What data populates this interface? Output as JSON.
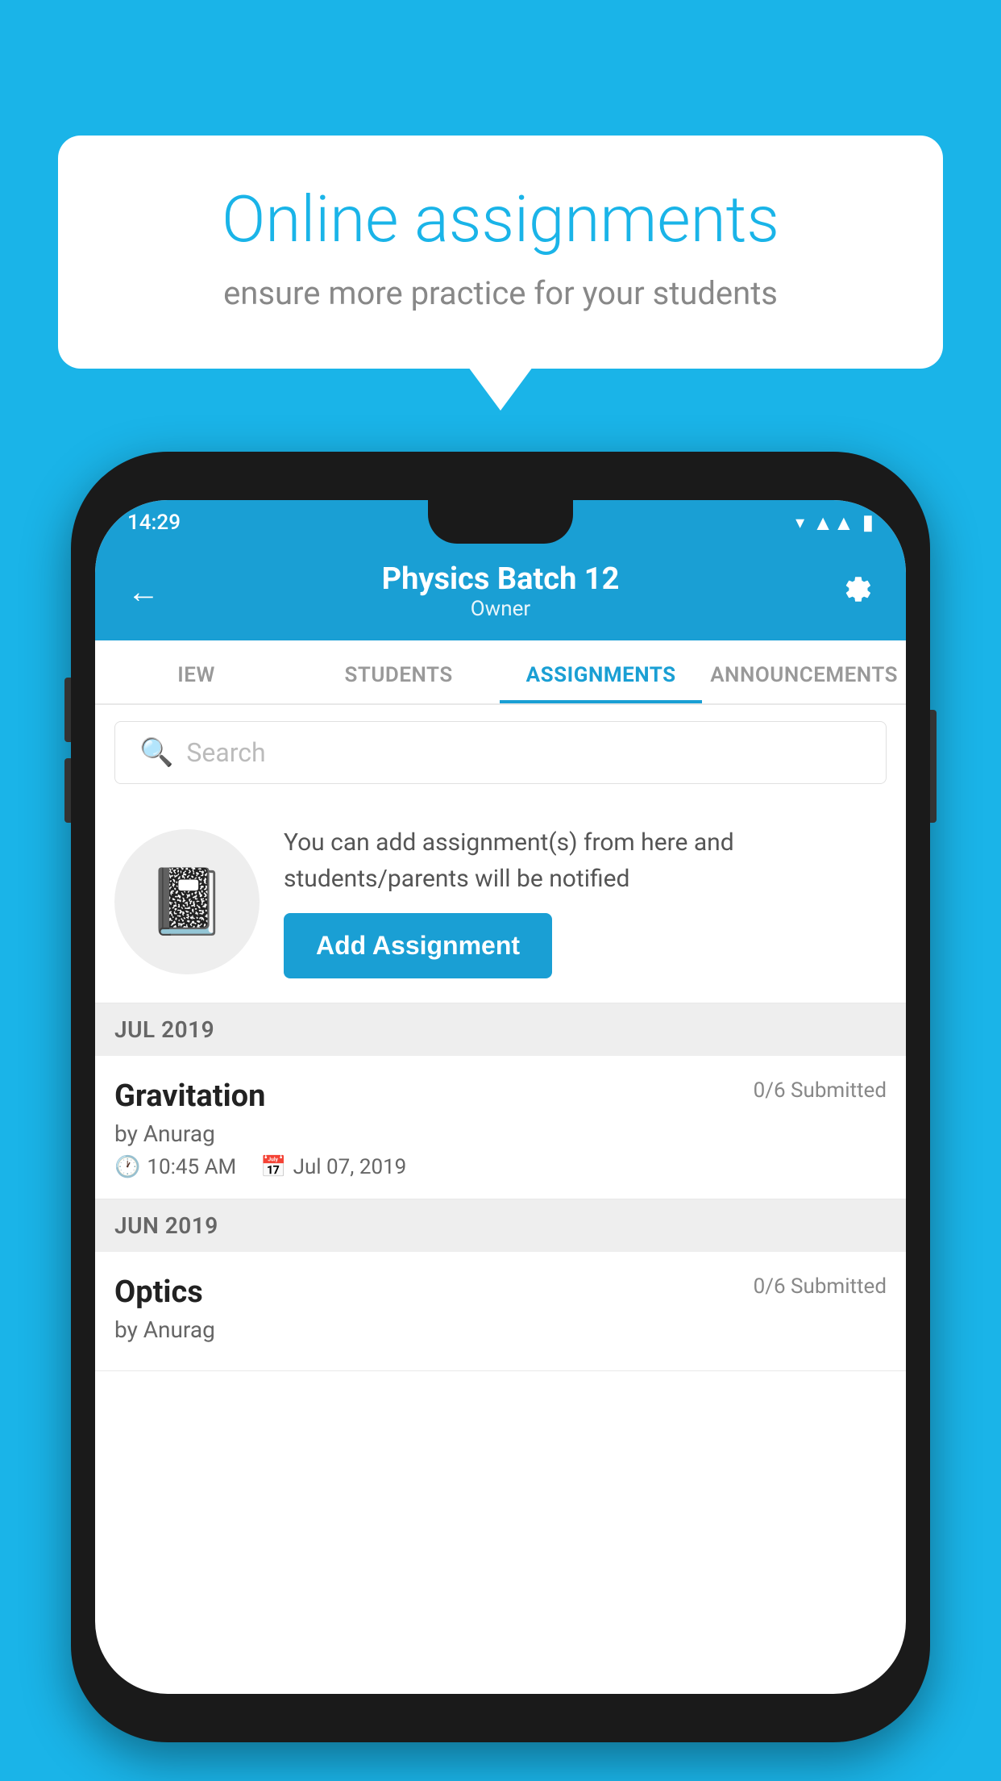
{
  "background_color": "#1ab4e8",
  "speech_bubble": {
    "title": "Online assignments",
    "subtitle": "ensure more practice for your students"
  },
  "status_bar": {
    "time": "14:29",
    "icons": [
      "wifi",
      "signal",
      "battery"
    ]
  },
  "header": {
    "title": "Physics Batch 12",
    "subtitle": "Owner",
    "back_label": "←",
    "settings_label": "⚙"
  },
  "tabs": [
    {
      "label": "IEW",
      "active": false
    },
    {
      "label": "STUDENTS",
      "active": false
    },
    {
      "label": "ASSIGNMENTS",
      "active": true
    },
    {
      "label": "ANNOUNCEMENTS",
      "active": false
    }
  ],
  "search": {
    "placeholder": "Search"
  },
  "add_assignment_card": {
    "description": "You can add assignment(s) from here and students/parents will be notified",
    "button_label": "Add Assignment"
  },
  "sections": [
    {
      "header": "JUL 2019",
      "items": [
        {
          "name": "Gravitation",
          "submitted": "0/6 Submitted",
          "by": "by Anurag",
          "time": "10:45 AM",
          "date": "Jul 07, 2019"
        }
      ]
    },
    {
      "header": "JUN 2019",
      "items": [
        {
          "name": "Optics",
          "submitted": "0/6 Submitted",
          "by": "by Anurag",
          "time": "",
          "date": ""
        }
      ]
    }
  ]
}
